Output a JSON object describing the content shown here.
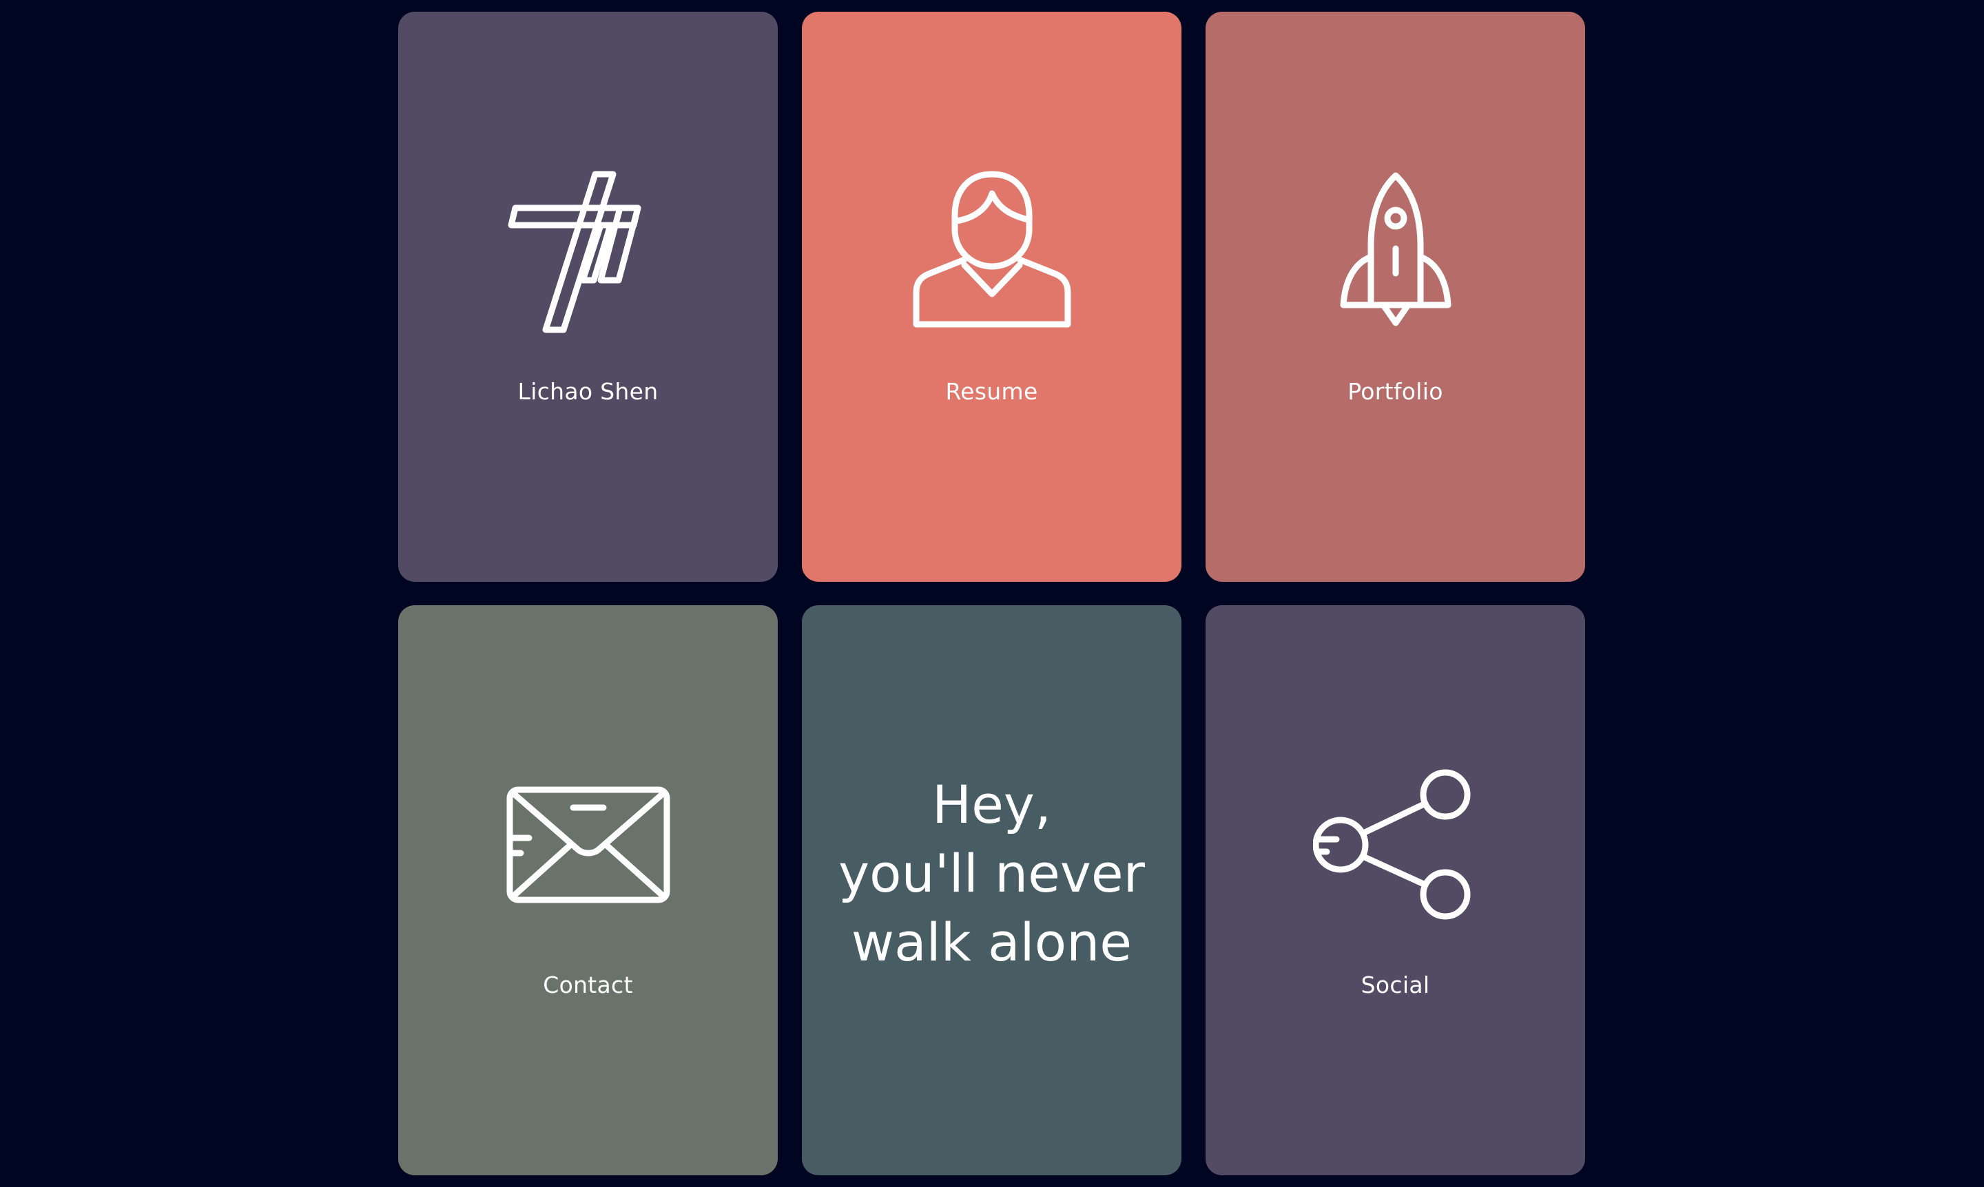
{
  "colors": {
    "background": "#000521",
    "purple": "#534A64",
    "salmon": "#E1766B",
    "rose": "#B66C69",
    "sage": "#69736A",
    "slate": "#485C63"
  },
  "cards": [
    {
      "label": "Lichao Shen",
      "icon": "monogram-logo-icon"
    },
    {
      "label": "Resume",
      "icon": "person-icon"
    },
    {
      "label": "Portfolio",
      "icon": "rocket-icon"
    },
    {
      "label": "Contact",
      "icon": "envelope-icon"
    },
    {
      "quote": [
        "Hey,",
        "you'll never",
        "walk alone"
      ]
    },
    {
      "label": "Social",
      "icon": "share-icon"
    }
  ]
}
